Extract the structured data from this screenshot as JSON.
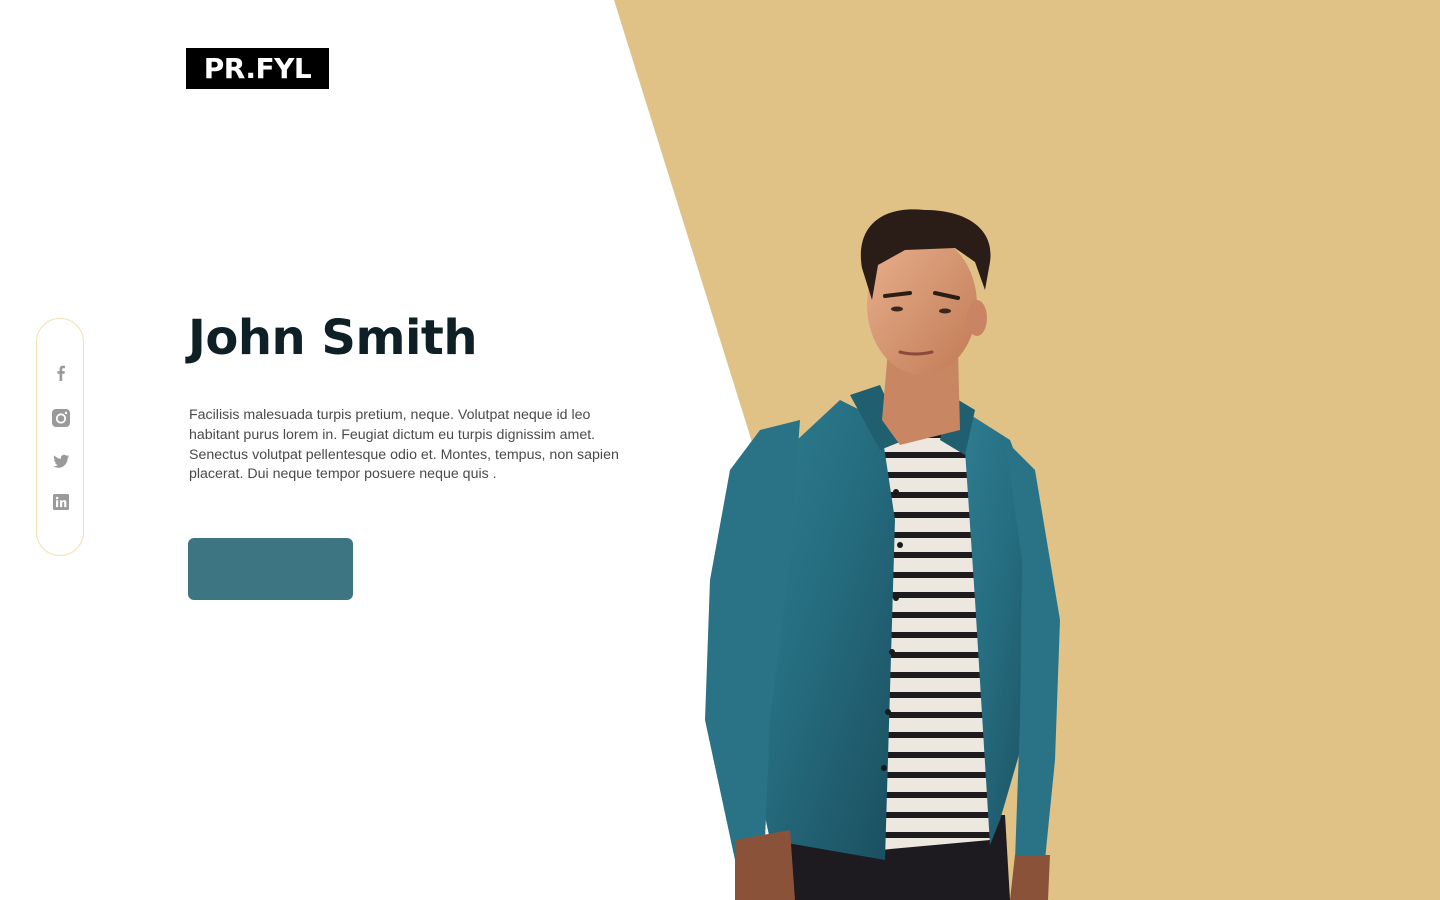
{
  "logo": {
    "text": "PR.FYL"
  },
  "hero": {
    "name": "John Smith",
    "description": "Facilisis malesuada turpis pretium, neque. Volutpat neque id leo habitant purus lorem in. Feugiat dictum eu turpis dignissim amet. Senectus volutpat pellentesque odio et. Montes, tempus, non sapien placerat. Dui neque tempor posuere neque quis .",
    "cta_label": ""
  },
  "social": {
    "items": [
      {
        "icon": "facebook-icon"
      },
      {
        "icon": "instagram-icon"
      },
      {
        "icon": "twitter-icon"
      },
      {
        "icon": "linkedin-icon"
      }
    ]
  },
  "colors": {
    "background": "#ffffff",
    "accent_backdrop": "#e0c286",
    "title": "#0e1f26",
    "body_text": "#4a4a4a",
    "cta": "#3e7583",
    "rail_border": "#f3dfb2",
    "icon": "#9a9a9a"
  }
}
